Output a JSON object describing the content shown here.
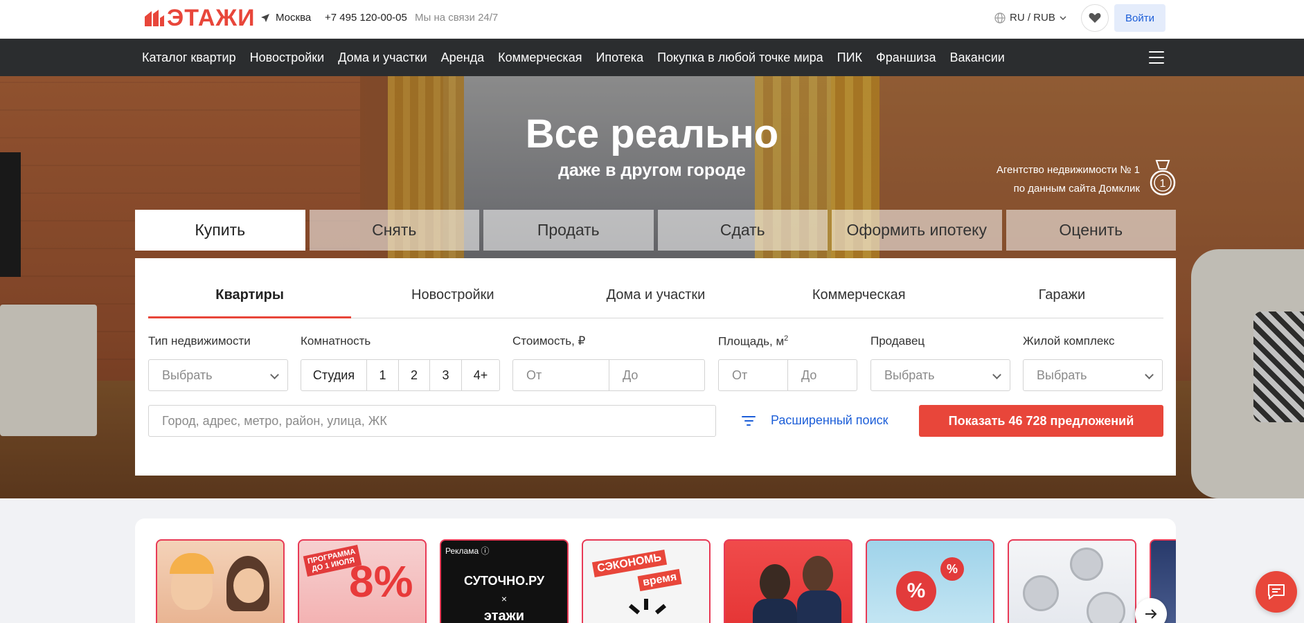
{
  "header": {
    "logo_text": "ЭТАЖИ",
    "city": "Москва",
    "phone": "+7 495 120-00-05",
    "support": "Мы на связи 24/7",
    "lang": "RU / RUB",
    "login": "Войти"
  },
  "nav": {
    "items": [
      "Каталог квартир",
      "Новостройки",
      "Дома и участки",
      "Аренда",
      "Коммерческая",
      "Ипотека",
      "Покупка в любой точке мира",
      "ПИК",
      "Франшиза",
      "Вакансии"
    ]
  },
  "hero": {
    "title": "Все реально",
    "subtitle": "даже в другом городе",
    "badge_line1": "Агентство недвижимости № 1",
    "badge_line2": "по данным сайта Домклик",
    "badge_number": "1"
  },
  "deal_tabs": [
    "Купить",
    "Снять",
    "Продать",
    "Сдать",
    "Оформить ипотеку",
    "Оценить"
  ],
  "type_tabs": [
    "Квартиры",
    "Новостройки",
    "Дома и участки",
    "Коммерческая",
    "Гаражи"
  ],
  "filters": {
    "type_label": "Тип недвижимости",
    "type_value": "Выбрать",
    "rooms_label": "Комнатность",
    "rooms": [
      "Студия",
      "1",
      "2",
      "3",
      "4+"
    ],
    "price_label": "Стоимость, ₽",
    "price_from": "От",
    "price_to": "До",
    "area_label": "Площадь, м",
    "area_sup": "2",
    "area_from": "От",
    "area_to": "До",
    "seller_label": "Продавец",
    "seller_value": "Выбрать",
    "complex_label": "Жилой комплекс",
    "complex_value": "Выбрать",
    "address_placeholder": "Город, адрес, метро, район, улица, ЖК",
    "advanced": "Расширенный поиск",
    "show_button": "Показать 46 728 предложений"
  },
  "promos": {
    "card2_text": "ПРОГРАММА ДО 1 ИЮЛЯ",
    "card2_big": "8%",
    "card3_ad": "Реклама ⓘ",
    "card3_line1": "СУТОЧНО.РУ",
    "card3_line2": "×",
    "card3_line3": "этажи",
    "card4_text1": "СЭКОНОМЬ",
    "card4_text2": "время"
  },
  "colors": {
    "accent": "#e8463a",
    "link": "#1c5ed8",
    "nav_bg": "#2b2d2f"
  }
}
